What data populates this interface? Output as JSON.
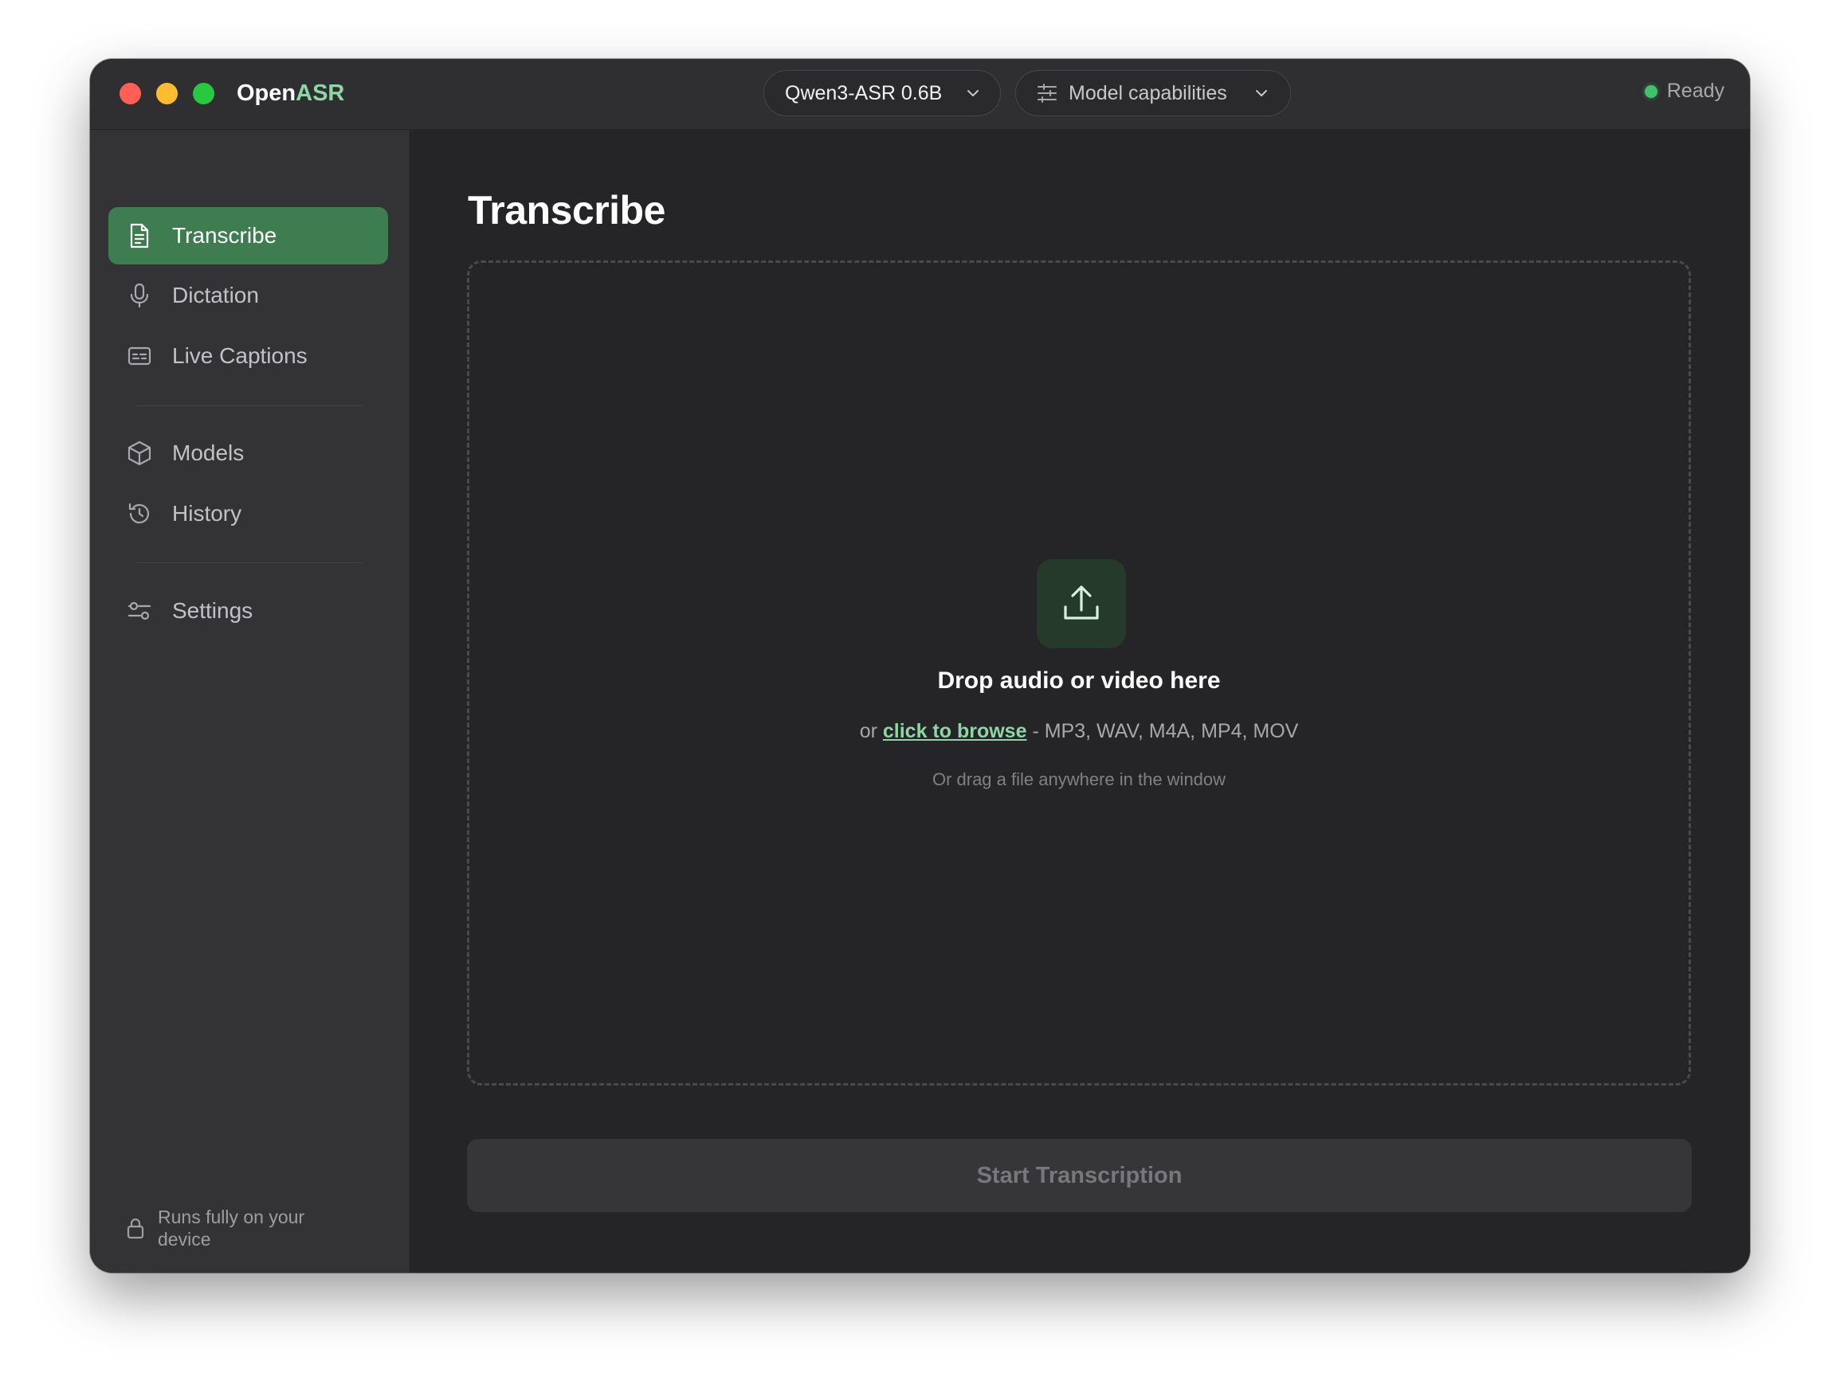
{
  "app": {
    "title_prefix": "Open",
    "title_accent": "ASR",
    "accent_color": "#8fd6a5"
  },
  "header": {
    "model_select": {
      "label": "Qwen3-ASR 0.6B",
      "icon": "chevron-down-icon"
    },
    "capabilities": {
      "label": "Model capabilities",
      "icon": "sliders-icon"
    },
    "status": {
      "label": "Ready",
      "color": "#3fc46b"
    }
  },
  "sidebar": {
    "items": [
      {
        "label": "Transcribe",
        "icon": "document-icon",
        "active": true
      },
      {
        "label": "Dictation",
        "icon": "microphone-icon"
      },
      {
        "label": "Live Captions",
        "icon": "captions-icon"
      },
      {
        "label": "Models",
        "icon": "cube-icon"
      },
      {
        "label": "History",
        "icon": "history-icon"
      },
      {
        "label": "Settings",
        "icon": "settings-sliders-icon"
      }
    ],
    "footer": {
      "text": "Runs fully on your device",
      "icon": "lock-icon"
    },
    "active_color": "#3e7d4f"
  },
  "main": {
    "title": "Transcribe",
    "dropzone": {
      "icon": "upload-icon",
      "title": "Drop audio or video here",
      "prefix": "or ",
      "browse_link": "click to browse",
      "formats": " - MP3, WAV, M4A, MP4, MOV",
      "hint": "Or drag a file anywhere in the window"
    },
    "start_button": "Start Transcription"
  }
}
